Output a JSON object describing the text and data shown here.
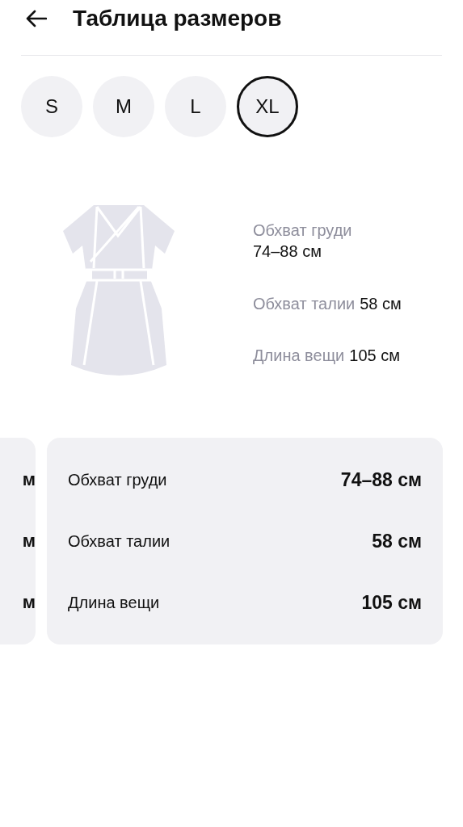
{
  "header": {
    "title": "Таблица размеров"
  },
  "sizes": [
    {
      "label": "S",
      "selected": false
    },
    {
      "label": "M",
      "selected": false
    },
    {
      "label": "L",
      "selected": false
    },
    {
      "label": "XL",
      "selected": true
    }
  ],
  "measurements": [
    {
      "label": "Обхват груди",
      "value": "74–88 см"
    },
    {
      "label": "Обхват талии",
      "value": "58 см"
    },
    {
      "label": "Длина вещи",
      "value": "105 см"
    }
  ],
  "previous_card": {
    "values": [
      "м",
      "м",
      "м"
    ]
  },
  "card": {
    "rows": [
      {
        "label": "Обхват груди",
        "value": "74–88 см"
      },
      {
        "label": "Обхват талии",
        "value": "58 см"
      },
      {
        "label": "Длина вещи",
        "value": "105 см"
      }
    ]
  }
}
